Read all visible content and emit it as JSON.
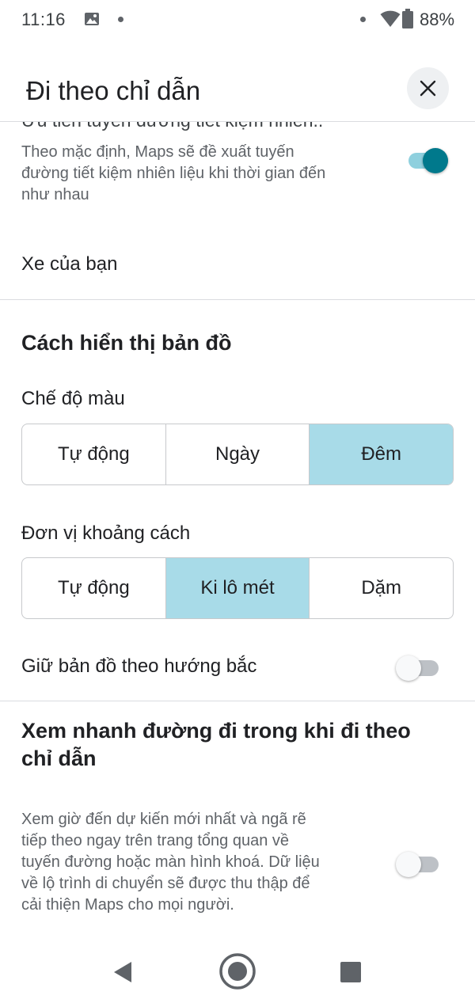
{
  "status_bar": {
    "time": "11:16",
    "battery_percent": "88%"
  },
  "header": {
    "title": "Đi theo chỉ dẫn",
    "close_icon": "close-icon"
  },
  "fuel_saving": {
    "title": "Ưu tiên tuyến đường tiết kiệm nhiên..",
    "description_lines": [
      "Theo mặc định, Maps sẽ đề xuất tuyến",
      "đường tiết kiệm nhiên liệu khi thời gian đến",
      "như nhau"
    ],
    "enabled": true
  },
  "your_vehicle": {
    "label": "Xe của bạn"
  },
  "map_display": {
    "heading": "Cách hiển thị bản đồ",
    "color_mode": {
      "label": "Chế độ màu",
      "options": [
        "Tự động",
        "Ngày",
        "Đêm"
      ],
      "selected": "Đêm"
    },
    "distance_units": {
      "label": "Đơn vị khoảng cách",
      "options": [
        "Tự động",
        "Ki lô mét",
        "Dặm"
      ],
      "selected": "Ki lô mét"
    },
    "keep_north_up": {
      "label": "Giữ bản đồ theo hướng bắc",
      "enabled": false
    }
  },
  "glanceable": {
    "heading_lines": [
      "Xem nhanh đường đi trong khi đi theo",
      "chỉ dẫn"
    ],
    "description_lines": [
      "Xem giờ đến dự kiến mới nhất và ngã rẽ",
      "tiếp theo ngay trên trang tổng quan về",
      "tuyến đường hoặc màn hình khoá. Dữ liệu",
      "về lộ trình di chuyển sẽ được thu thập để",
      "cải thiện Maps cho mọi người."
    ],
    "enabled": false
  },
  "colors": {
    "accent": "#00798c",
    "selected_segment": "#a8dbe8",
    "divider": "#dadce0"
  },
  "nav_bar": {
    "icons": [
      "back-icon",
      "home-icon",
      "recents-icon"
    ]
  }
}
